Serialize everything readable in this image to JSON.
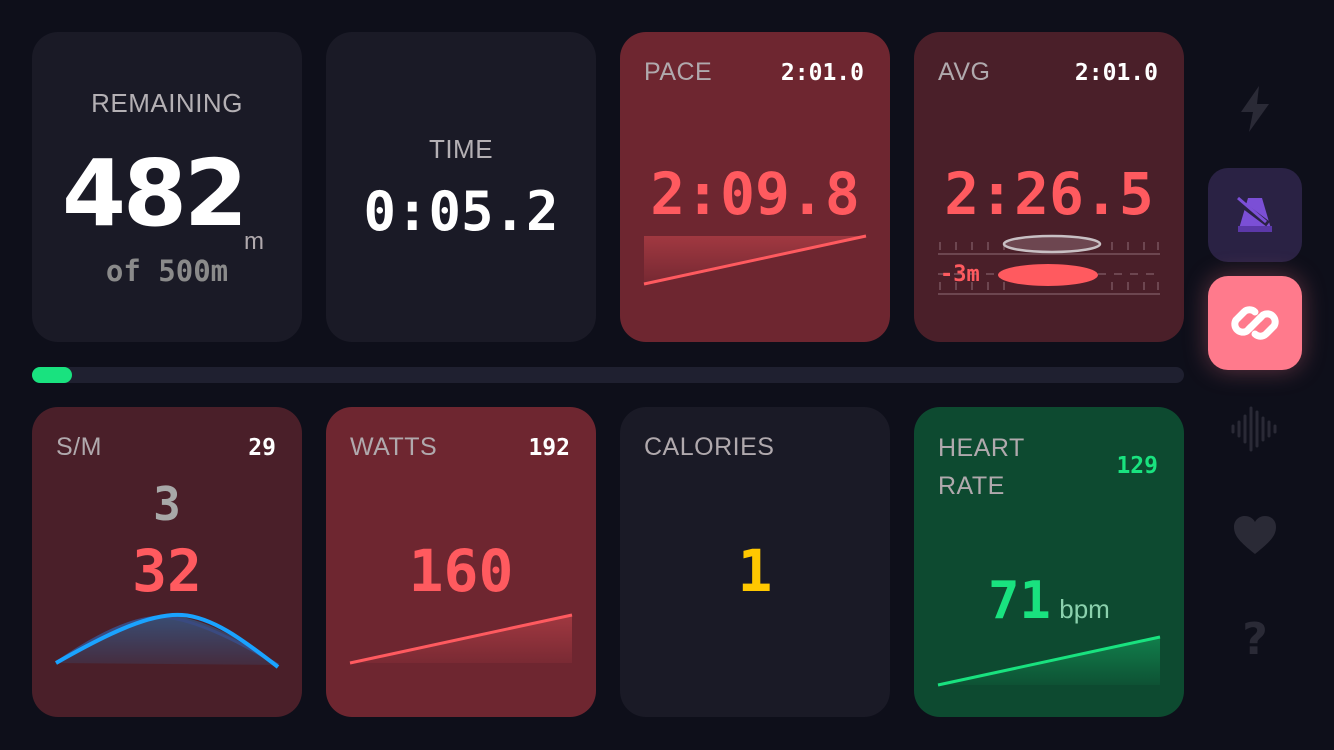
{
  "remaining": {
    "label": "REMAINING",
    "value": "482",
    "unit": "m",
    "sub": "of 500m"
  },
  "time": {
    "label": "TIME",
    "value": "0:05.2"
  },
  "pace": {
    "label": "PACE",
    "corner": "2:01.0",
    "value": "2:09.8"
  },
  "avg": {
    "label": "AVG",
    "corner": "2:01.0",
    "value": "2:26.5",
    "delta": "-3m"
  },
  "progress": {
    "fraction": 0.035
  },
  "spm": {
    "label": "S/M",
    "corner": "29",
    "secondary": "3",
    "value": "32"
  },
  "watts": {
    "label": "WATTS",
    "corner": "192",
    "value": "160"
  },
  "calories": {
    "label": "CALORIES",
    "value": "1"
  },
  "heart_rate": {
    "label_line1": "HEART",
    "label_line2": "RATE",
    "corner": "129",
    "value": "71",
    "unit": "bpm"
  },
  "sidebar": {
    "items": [
      {
        "icon": "lightning-icon",
        "active": false
      },
      {
        "icon": "metronome-icon",
        "active": true
      },
      {
        "icon": "link-icon",
        "active": true
      },
      {
        "icon": "waveform-icon",
        "active": false
      },
      {
        "icon": "heart-icon",
        "active": false
      },
      {
        "icon": "help-icon",
        "active": false
      }
    ]
  },
  "colors": {
    "accent_red": "#ff5a5f",
    "accent_green": "#19e27f",
    "accent_yellow": "#ffc800",
    "accent_blue": "#1aa3ff",
    "link_pink": "#ff7a8c"
  }
}
